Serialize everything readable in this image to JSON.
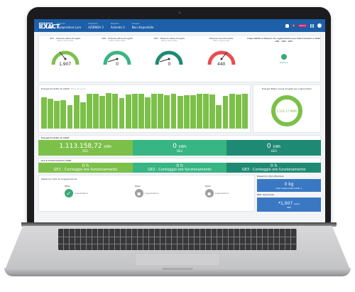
{
  "app": {
    "logo": "EXACT"
  },
  "topbar": {
    "groups": [
      {
        "label": "Azienda",
        "value": "Cooperativa Lum"
      },
      {
        "label": "Impianto",
        "value": "AZIENDA 3"
      },
      {
        "label": "Reparto",
        "value": "Azienda 3"
      },
      {
        "label": "Gruppo",
        "value": "Non disponibile"
      }
    ],
    "notif_badge": "3",
    "user_badge": "Admin"
  },
  "gauges": [
    {
      "title": "GE1 - Potenza Attiva Erogata",
      "subtitle": "Ultimo valore letto",
      "value": "1,907",
      "color": "#7cc04a"
    },
    {
      "title": "GE2 - Potenza Attiva Erogata",
      "subtitle": "Ultimo valore letto",
      "value": "0",
      "color": "#37b582"
    },
    {
      "title": "GE3 - Potenza Attiva Erogata",
      "subtitle": "Ultimo valore letto",
      "value": "0",
      "color": "#1f8a73"
    },
    {
      "title": "Potenza Scambio Rete",
      "subtitle": "Ultimo valore letto",
      "value": "440",
      "color": "#e84e4e"
    }
  ],
  "availability": {
    "title": "Disponibilità al Prelievo da cogenerazione per bilanciamento in Rete GE1 - GE2 - GE3",
    "status": "Prelievo"
  },
  "energy_chart": {
    "title": "Energia Prodotta da COGE",
    "subtitle": "Ultimi 30 giorni",
    "values": [
      40,
      38,
      35,
      36,
      30,
      42,
      33,
      44,
      44,
      41,
      45,
      44,
      39,
      43,
      44,
      44,
      40,
      44,
      44,
      42,
      44,
      41,
      42,
      42,
      44,
      44,
      43,
      30,
      41,
      44,
      43,
      44
    ]
  },
  "donut": {
    "title": "Energia Totale annua erogata per cogeneratori",
    "value": "1,121.17 MWh"
  },
  "kpi_energy": {
    "title": "Energia Prodotta da COGE",
    "items": [
      {
        "value": "1.113.158,72",
        "unit": "kWh",
        "label": "GE1"
      },
      {
        "value": "0",
        "unit": "kWh",
        "label": "GE2"
      },
      {
        "value": "0",
        "unit": "kWh",
        "label": "GE3"
      }
    ]
  },
  "kpi_hours": {
    "title": "Ore di funzionamento COGE",
    "items": [
      {
        "value": "0 h",
        "label": "GE1 - Conteggio ore funzionamento"
      },
      {
        "value": "0 h",
        "label": "GE2 - Conteggio ore funzionamento"
      },
      {
        "value": "0 h",
        "label": "GE3 - Conteggio ore funzionamento"
      }
    ]
  },
  "co2": {
    "title": "Risparmio CO2 da Cogenerazione",
    "states": [
      {
        "title": "Stato",
        "label": "Cogeneratore 1"
      },
      {
        "title": "Stato",
        "label": "Cogeneratore 2"
      },
      {
        "title": "Stato",
        "label": "Cogeneratore 3"
      }
    ]
  },
  "right_panel": {
    "title": "Risparmio CO2 ottenibile",
    "box1": {
      "value": "0 kg",
      "label": "CO2 risparmiata CAML 1"
    },
    "box2_title": "PEE risparmiata",
    "box2": {
      "value": "*1,007",
      "unit": "tep/h",
      "label": "PEE"
    }
  }
}
